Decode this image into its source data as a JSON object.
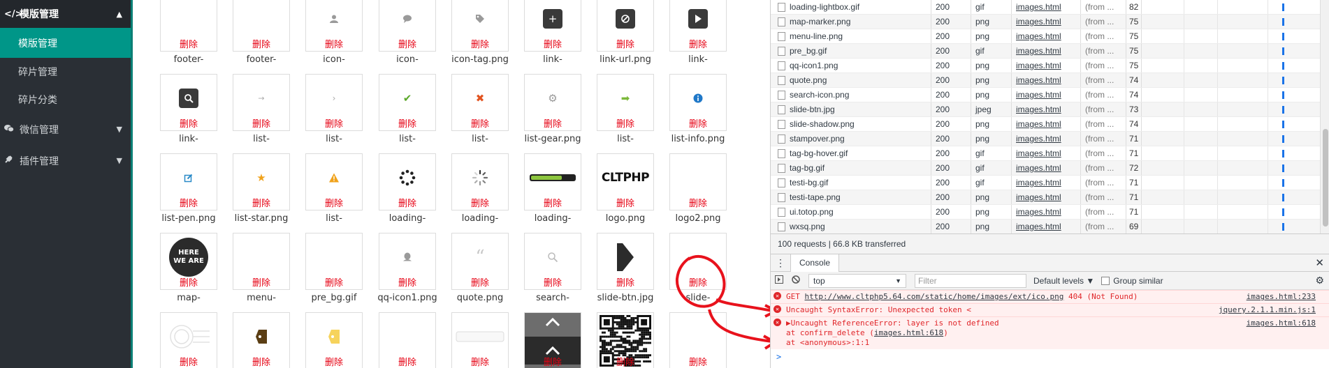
{
  "sidebar": {
    "header": {
      "icon": "</>",
      "label": "模版管理"
    },
    "items": [
      {
        "label": "模版管理",
        "active": true
      },
      {
        "label": "碎片管理"
      },
      {
        "label": "碎片分类"
      }
    ],
    "groups": [
      {
        "icon": "wechat-icon",
        "label": "微信管理"
      },
      {
        "icon": "plug-icon",
        "label": "插件管理"
      }
    ]
  },
  "grid": {
    "delete_label": "删除",
    "rows": [
      [
        "footer-",
        "footer-",
        "icon-",
        "icon-",
        "icon-tag.png",
        "link-",
        "link-url.png",
        "link-"
      ],
      [
        "link-",
        "list-",
        "list-",
        "list-",
        "list-",
        "list-gear.png",
        "list-",
        "list-info.png"
      ],
      [
        "list-pen.png",
        "list-star.png",
        "list-",
        "loading-",
        "loading-",
        "loading-",
        "logo.png",
        "logo2.png"
      ],
      [
        "map-",
        "menu-",
        "pre_bg.gif",
        "qq-icon1.png",
        "quote.png",
        "search-",
        "slide-btn.jpg",
        "slide-"
      ],
      [
        "",
        "",
        "",
        "",
        "",
        "",
        "",
        ""
      ]
    ],
    "logo_text": "CLTPHP",
    "map_badge": "HERE\nWE ARE"
  },
  "network": {
    "rows": [
      {
        "name": "loading-lightbox.gif",
        "status": "200",
        "type": "gif",
        "initiator": "images.html",
        "size": "(from ...",
        "time": "82"
      },
      {
        "name": "map-marker.png",
        "status": "200",
        "type": "png",
        "initiator": "images.html",
        "size": "(from ...",
        "time": "75"
      },
      {
        "name": "menu-line.png",
        "status": "200",
        "type": "png",
        "initiator": "images.html",
        "size": "(from ...",
        "time": "75"
      },
      {
        "name": "pre_bg.gif",
        "status": "200",
        "type": "gif",
        "initiator": "images.html",
        "size": "(from ...",
        "time": "75"
      },
      {
        "name": "qq-icon1.png",
        "status": "200",
        "type": "png",
        "initiator": "images.html",
        "size": "(from ...",
        "time": "75"
      },
      {
        "name": "quote.png",
        "status": "200",
        "type": "png",
        "initiator": "images.html",
        "size": "(from ...",
        "time": "74"
      },
      {
        "name": "search-icon.png",
        "status": "200",
        "type": "png",
        "initiator": "images.html",
        "size": "(from ...",
        "time": "74"
      },
      {
        "name": "slide-btn.jpg",
        "status": "200",
        "type": "jpeg",
        "initiator": "images.html",
        "size": "(from ...",
        "time": "73"
      },
      {
        "name": "slide-shadow.png",
        "status": "200",
        "type": "png",
        "initiator": "images.html",
        "size": "(from ...",
        "time": "74"
      },
      {
        "name": "stampover.png",
        "status": "200",
        "type": "png",
        "initiator": "images.html",
        "size": "(from ...",
        "time": "71"
      },
      {
        "name": "tag-bg-hover.gif",
        "status": "200",
        "type": "gif",
        "initiator": "images.html",
        "size": "(from ...",
        "time": "71"
      },
      {
        "name": "tag-bg.gif",
        "status": "200",
        "type": "gif",
        "initiator": "images.html",
        "size": "(from ...",
        "time": "72"
      },
      {
        "name": "testi-bg.gif",
        "status": "200",
        "type": "gif",
        "initiator": "images.html",
        "size": "(from ...",
        "time": "71"
      },
      {
        "name": "testi-tape.png",
        "status": "200",
        "type": "png",
        "initiator": "images.html",
        "size": "(from ...",
        "time": "71"
      },
      {
        "name": "ui.totop.png",
        "status": "200",
        "type": "png",
        "initiator": "images.html",
        "size": "(from ...",
        "time": "71"
      },
      {
        "name": "wxsq.png",
        "status": "200",
        "type": "png",
        "initiator": "images.html",
        "size": "(from ...",
        "time": "69"
      }
    ],
    "summary": "100 requests  |  66.8 KB transferred"
  },
  "console": {
    "tab": "Console",
    "context": "top",
    "filter_placeholder": "Filter",
    "levels": "Default levels ▼",
    "group_similar": "Group similar",
    "errors": [
      {
        "pre": "GET ",
        "link": "http://www.cltphp5.64.com/static/home/images/ext/ico.png",
        "post": " 404 (Not Found)",
        "src": "images.html:233"
      },
      {
        "pre": "Uncaught SyntaxError: Unexpected token <",
        "link": "",
        "post": "",
        "src": "jquery.2.1.1.min.js:1"
      },
      {
        "pre": "▶Uncaught ReferenceError: layer is not defined",
        "link": "",
        "post": "",
        "src": "images.html:618",
        "stack": [
          "    at confirm_delete (",
          "images.html:618",
          ")",
          "    at <anonymous>:1:1"
        ]
      }
    ],
    "prompt": ">"
  },
  "colors": {
    "sidebar": "#2a2f35",
    "active": "#009688",
    "delete": "#e60012",
    "error": "#e0262a"
  }
}
